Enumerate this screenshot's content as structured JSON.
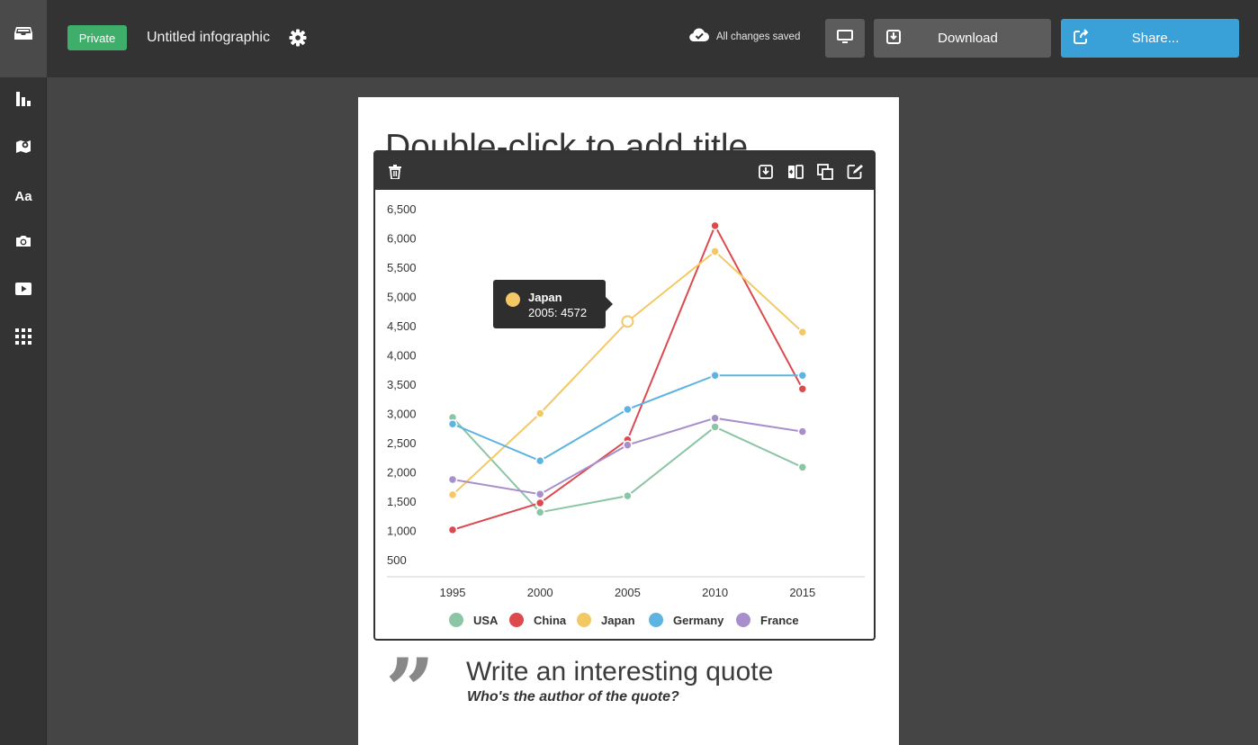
{
  "topbar": {
    "privacy_badge": "Private",
    "document_title": "Untitled infographic",
    "save_status": "All changes saved",
    "download_label": "Download",
    "share_label": "Share..."
  },
  "sidebar": {
    "text_tool_label": "Aa",
    "items": [
      "inbox-icon",
      "bar-chart-icon",
      "map-icon",
      "text-icon",
      "camera-icon",
      "video-icon",
      "grid-icon"
    ]
  },
  "page": {
    "title_placeholder": "Double-click to add title",
    "quote_mark": "”",
    "quote_text": "Write an interesting quote",
    "quote_author": "Who's the author of the quote?"
  },
  "widget_toolbar": [
    "trash-icon",
    "download-icon",
    "swap-icon",
    "duplicate-icon",
    "edit-icon"
  ],
  "tooltip": {
    "series": "Japan",
    "text": "2005: 4572",
    "color": "#f3c966"
  },
  "colors": {
    "accent_green": "#3fae6b",
    "accent_blue": "#3aa0d8"
  },
  "chart_data": {
    "type": "line",
    "x": [
      "1995",
      "2000",
      "2005",
      "2010",
      "2015"
    ],
    "y_ticks": [
      "6,500",
      "6,000",
      "5,500",
      "5,000",
      "4,500",
      "4,000",
      "3,500",
      "3,000",
      "2,500",
      "2,000",
      "1,500",
      "1,000",
      "500"
    ],
    "ylim": [
      500,
      6500
    ],
    "highlight": {
      "series": "Japan",
      "x": "2005"
    },
    "legend_position": "bottom",
    "series": [
      {
        "name": "USA",
        "color": "#8cc5a5",
        "values": [
          2930,
          1310,
          1590,
          2770,
          2080
        ]
      },
      {
        "name": "China",
        "color": "#dc4a4f",
        "values": [
          1010,
          1470,
          2550,
          6210,
          3420
        ]
      },
      {
        "name": "Japan",
        "color": "#f3c966",
        "values": [
          1610,
          3000,
          4572,
          5770,
          4390
        ]
      },
      {
        "name": "Germany",
        "color": "#5db3e2",
        "values": [
          2820,
          2190,
          3070,
          3650,
          3650
        ]
      },
      {
        "name": "France",
        "color": "#a88ecb",
        "values": [
          1870,
          1620,
          2460,
          2920,
          2690
        ]
      }
    ]
  }
}
